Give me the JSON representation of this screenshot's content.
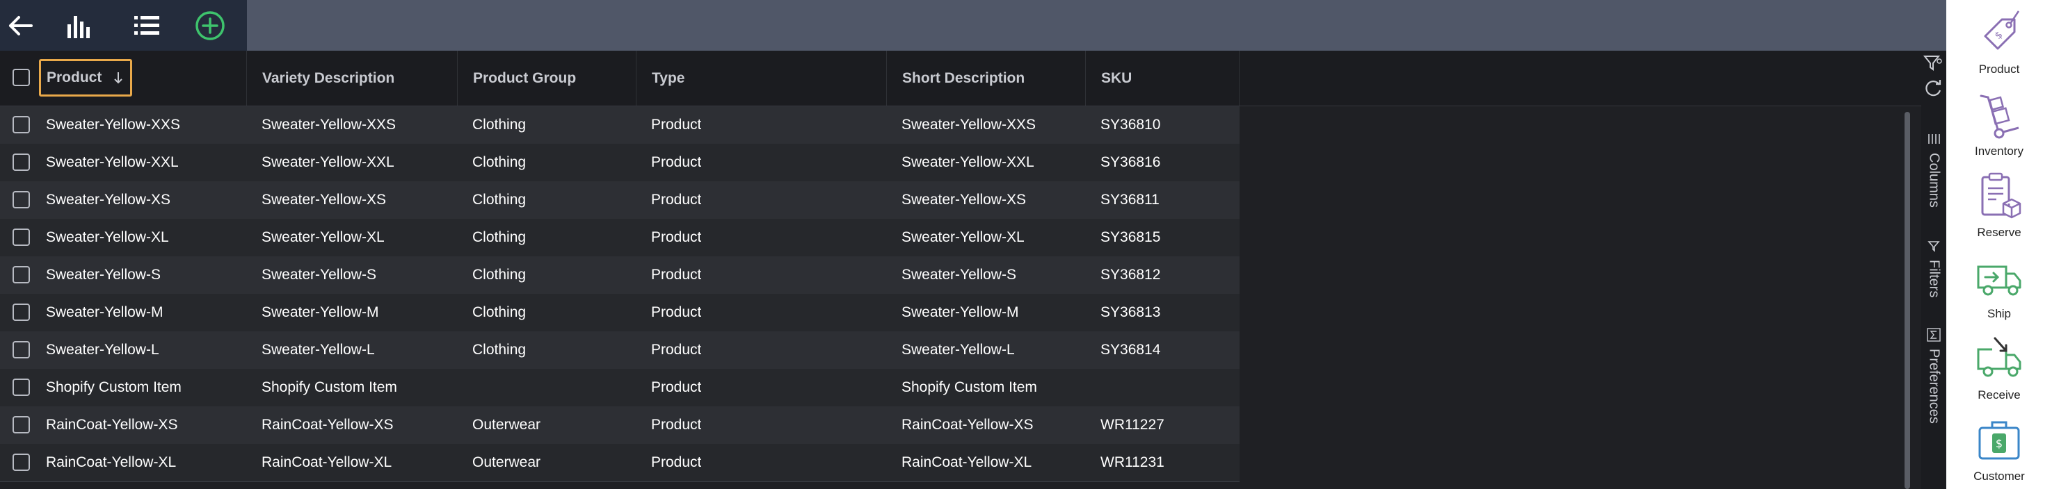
{
  "toolbar": {
    "icons": [
      "arrow-left-icon",
      "bar-chart-icon",
      "list-icon",
      "add-circle-icon"
    ],
    "accent": "#3ec46d"
  },
  "grid": {
    "sorted_column": "Product",
    "sort_direction": "descending",
    "headers": {
      "product": "Product",
      "variety": "Variety Description",
      "group": "Product Group",
      "type": "Type",
      "short": "Short Description",
      "sku": "SKU"
    },
    "rows": [
      {
        "product": "Sweater-Yellow-XXS",
        "variety": "Sweater-Yellow-XXS",
        "group": "Clothing",
        "type": "Product",
        "short": "Sweater-Yellow-XXS",
        "sku": "SY36810"
      },
      {
        "product": "Sweater-Yellow-XXL",
        "variety": "Sweater-Yellow-XXL",
        "group": "Clothing",
        "type": "Product",
        "short": "Sweater-Yellow-XXL",
        "sku": "SY36816"
      },
      {
        "product": "Sweater-Yellow-XS",
        "variety": "Sweater-Yellow-XS",
        "group": "Clothing",
        "type": "Product",
        "short": "Sweater-Yellow-XS",
        "sku": "SY36811"
      },
      {
        "product": "Sweater-Yellow-XL",
        "variety": "Sweater-Yellow-XL",
        "group": "Clothing",
        "type": "Product",
        "short": "Sweater-Yellow-XL",
        "sku": "SY36815"
      },
      {
        "product": "Sweater-Yellow-S",
        "variety": "Sweater-Yellow-S",
        "group": "Clothing",
        "type": "Product",
        "short": "Sweater-Yellow-S",
        "sku": "SY36812"
      },
      {
        "product": "Sweater-Yellow-M",
        "variety": "Sweater-Yellow-M",
        "group": "Clothing",
        "type": "Product",
        "short": "Sweater-Yellow-M",
        "sku": "SY36813"
      },
      {
        "product": "Sweater-Yellow-L",
        "variety": "Sweater-Yellow-L",
        "group": "Clothing",
        "type": "Product",
        "short": "Sweater-Yellow-L",
        "sku": "SY36814"
      },
      {
        "product": "Shopify Custom Item",
        "variety": "Shopify Custom Item",
        "group": "",
        "type": "Product",
        "short": "Shopify Custom Item",
        "sku": ""
      },
      {
        "product": "RainCoat-Yellow-XS",
        "variety": "RainCoat-Yellow-XS",
        "group": "Outerwear",
        "type": "Product",
        "short": "RainCoat-Yellow-XS",
        "sku": "WR11227"
      },
      {
        "product": "RainCoat-Yellow-XL",
        "variety": "RainCoat-Yellow-XL",
        "group": "Outerwear",
        "type": "Product",
        "short": "RainCoat-Yellow-XL",
        "sku": "WR11231"
      }
    ]
  },
  "side_panel": {
    "columns": "Columns",
    "filters": "Filters",
    "preferences": "Preferences"
  },
  "right_nav": {
    "product": "Product",
    "inventory": "Inventory",
    "reserve": "Reserve",
    "ship": "Ship",
    "receive": "Receive",
    "customer": "Customer"
  },
  "colors": {
    "sort_highlight": "#e9a94a",
    "nav_purple": "#8a6fb3",
    "nav_green": "#4aa86a",
    "nav_blue": "#3a86c8"
  }
}
